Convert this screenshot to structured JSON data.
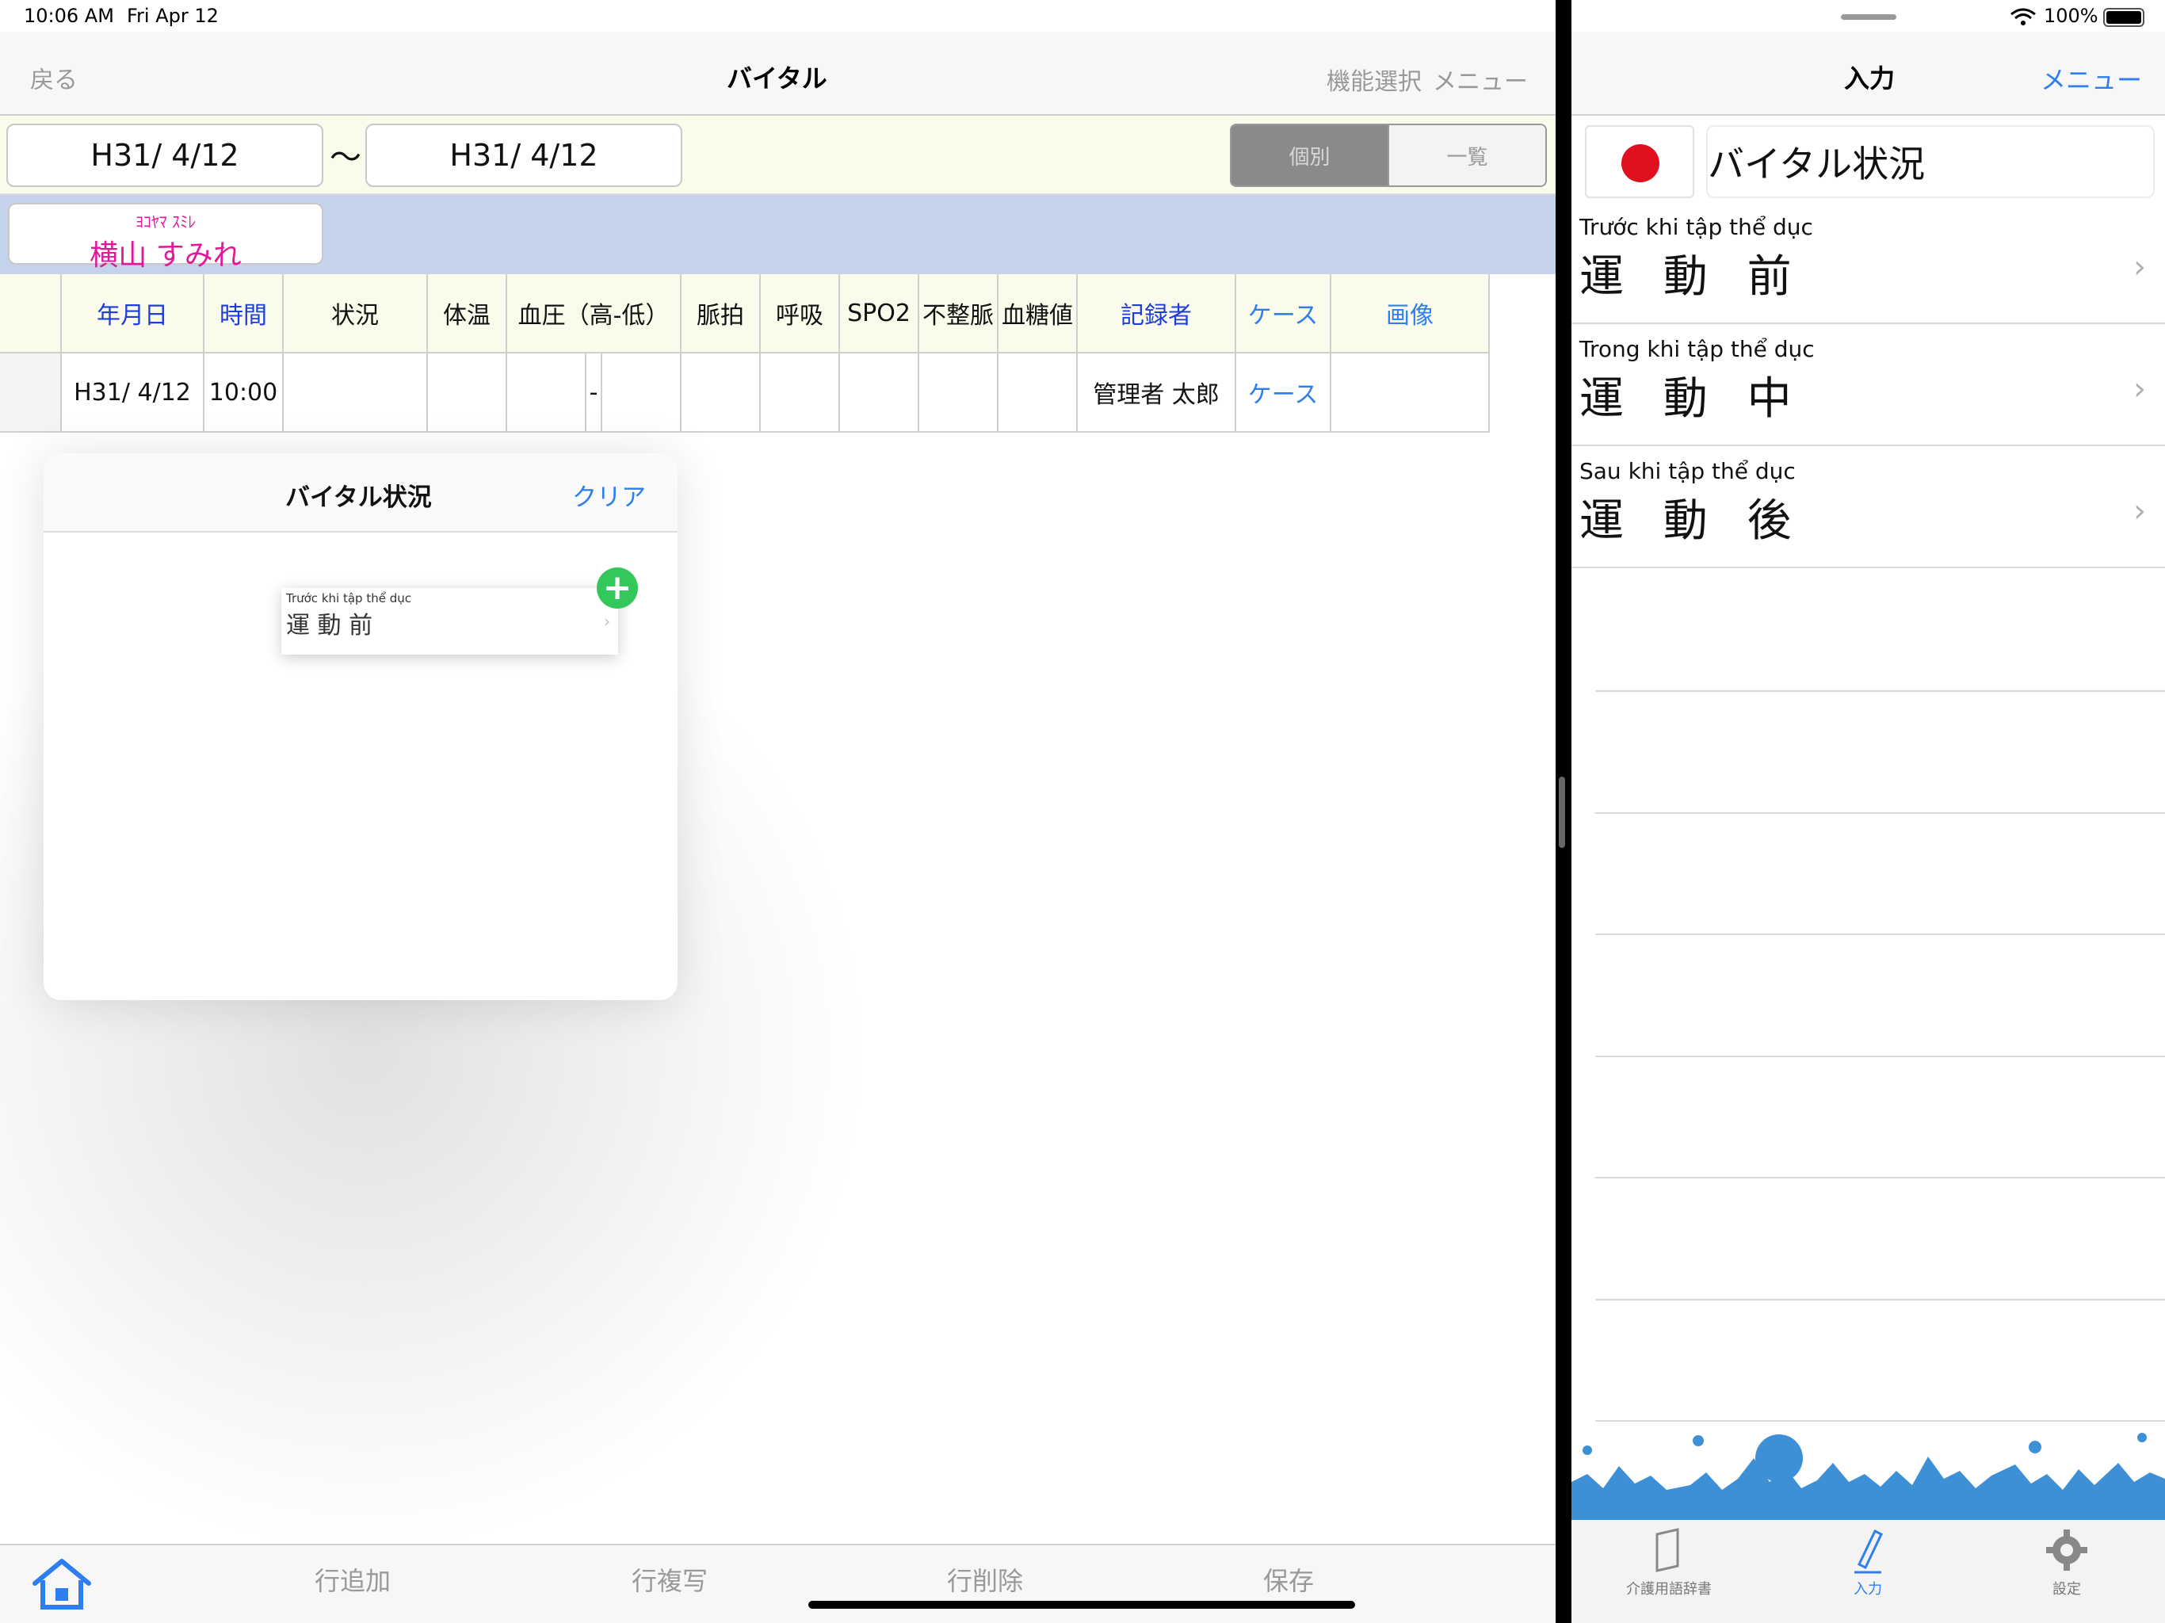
{
  "status_bar": {
    "time": "10:06 AM",
    "date": "Fri Apr 12",
    "battery": "100%"
  },
  "left_nav": {
    "back": "戻る",
    "title": "バイタル",
    "function_select": "機能選択",
    "menu": "メニュー"
  },
  "filter": {
    "date_from": "H31/ 4/12",
    "tilde": "〜",
    "date_to": "H31/ 4/12",
    "segment_individual": "個別",
    "segment_list": "一覧"
  },
  "resident": {
    "kana": "ﾖｺﾔﾏ ｽﾐﾚ",
    "name": "横山 すみれ"
  },
  "table": {
    "headers": [
      "",
      "年月日",
      "時間",
      "状況",
      "体温",
      "血圧（高-低）",
      "脈拍",
      "呼吸",
      "SPO2",
      "不整脈",
      "血糖値",
      "記録者",
      "ケース",
      "画像"
    ],
    "row": [
      "",
      "H31/ 4/12",
      "10:00",
      "",
      "",
      "-",
      "",
      "",
      "",
      "",
      "",
      "管理者 太郎",
      "ケース",
      ""
    ]
  },
  "popover": {
    "title": "バイタル状況",
    "clear": "クリア",
    "drag_item_vi": "Trước khi tập thể dục",
    "drag_item_jp": "運 動 前",
    "plus": "+"
  },
  "left_toolbar": {
    "add_row": "行追加",
    "copy_row": "行複写",
    "delete_row": "行削除",
    "save": "保存"
  },
  "right_nav": {
    "title": "入力",
    "menu": "メニュー"
  },
  "right_input": {
    "value": "バイタル状況"
  },
  "right_list": [
    {
      "vi": "Trước khi tập thể dục",
      "jp": "運 動 前"
    },
    {
      "vi": "Trong khi tập thể dục",
      "jp": "運 動 中"
    },
    {
      "vi": "Sau khi tập thể dục",
      "jp": "運 動 後"
    }
  ],
  "right_tabs": {
    "dictionary": "介護用語辞書",
    "input": "入力",
    "settings": "設定"
  },
  "colors": {
    "accent_blue": "#2d7ff0",
    "header_blue": "#1e3ddb",
    "name_pink": "#e0189a",
    "flag_red": "#e0101e",
    "banner_blue": "#3d8fd6",
    "add_green": "#34c759"
  }
}
